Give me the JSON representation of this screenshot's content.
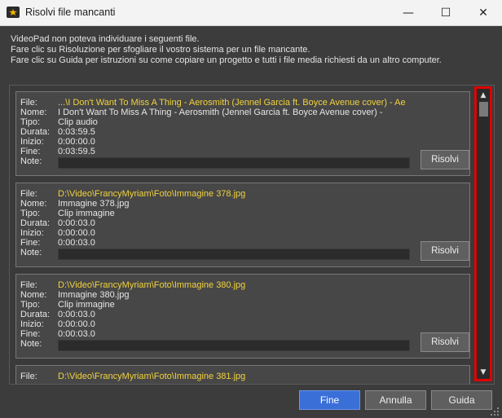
{
  "window": {
    "title": "Risolvi file mancanti",
    "minimize_glyph": "—",
    "maximize_glyph": "☐",
    "close_glyph": "✕"
  },
  "info_lines": [
    "VideoPad non poteva individuare i seguenti file.",
    "Fare clic su Risoluzione per sfogliare il vostro sistema per un file mancante.",
    "Fare clic su Guida per istruzioni su come copiare un progetto e tutti i file media richiesti da un altro computer."
  ],
  "labels": {
    "file": "File:",
    "name": "Nome:",
    "type": "Tipo:",
    "duration": "Durata:",
    "start": "Inizio:",
    "end": "Fine:",
    "notes": "Note:"
  },
  "entries": [
    {
      "file": "...\\I Don't Want To Miss A Thing - Aerosmith (Jennel Garcia ft. Boyce Avenue cover) - Ae",
      "name": "I Don't Want To Miss A Thing - Aerosmith (Jennel Garcia ft. Boyce Avenue cover) -",
      "type": "Clip audio",
      "duration": "0:03:59.5",
      "start": "0:00:00.0",
      "end": "0:03:59.5",
      "button": "Risolvi"
    },
    {
      "file": "D:\\Video\\FrancyMyriam\\Foto\\Immagine 378.jpg",
      "name": "Immagine 378.jpg",
      "type": "Clip immagine",
      "duration": "0:00:03.0",
      "start": "0:00:00.0",
      "end": "0:00:03.0",
      "button": "Risolvi"
    },
    {
      "file": "D:\\Video\\FrancyMyriam\\Foto\\Immagine 380.jpg",
      "name": "Immagine 380.jpg",
      "type": "Clip immagine",
      "duration": "0:00:03.0",
      "start": "0:00:00.0",
      "end": "0:00:03.0",
      "button": "Risolvi"
    },
    {
      "file": "D:\\Video\\FrancyMyriam\\Foto\\Immagine 381.jpg"
    }
  ],
  "scrollbar": {
    "up_glyph": "▲",
    "down_glyph": "▼",
    "highlight_color": "#e00000"
  },
  "footer": {
    "ok": "Fine",
    "cancel": "Annulla",
    "help": "Guida"
  },
  "colors": {
    "accent": "#3b6fd8",
    "file_path": "#f1d23c"
  }
}
